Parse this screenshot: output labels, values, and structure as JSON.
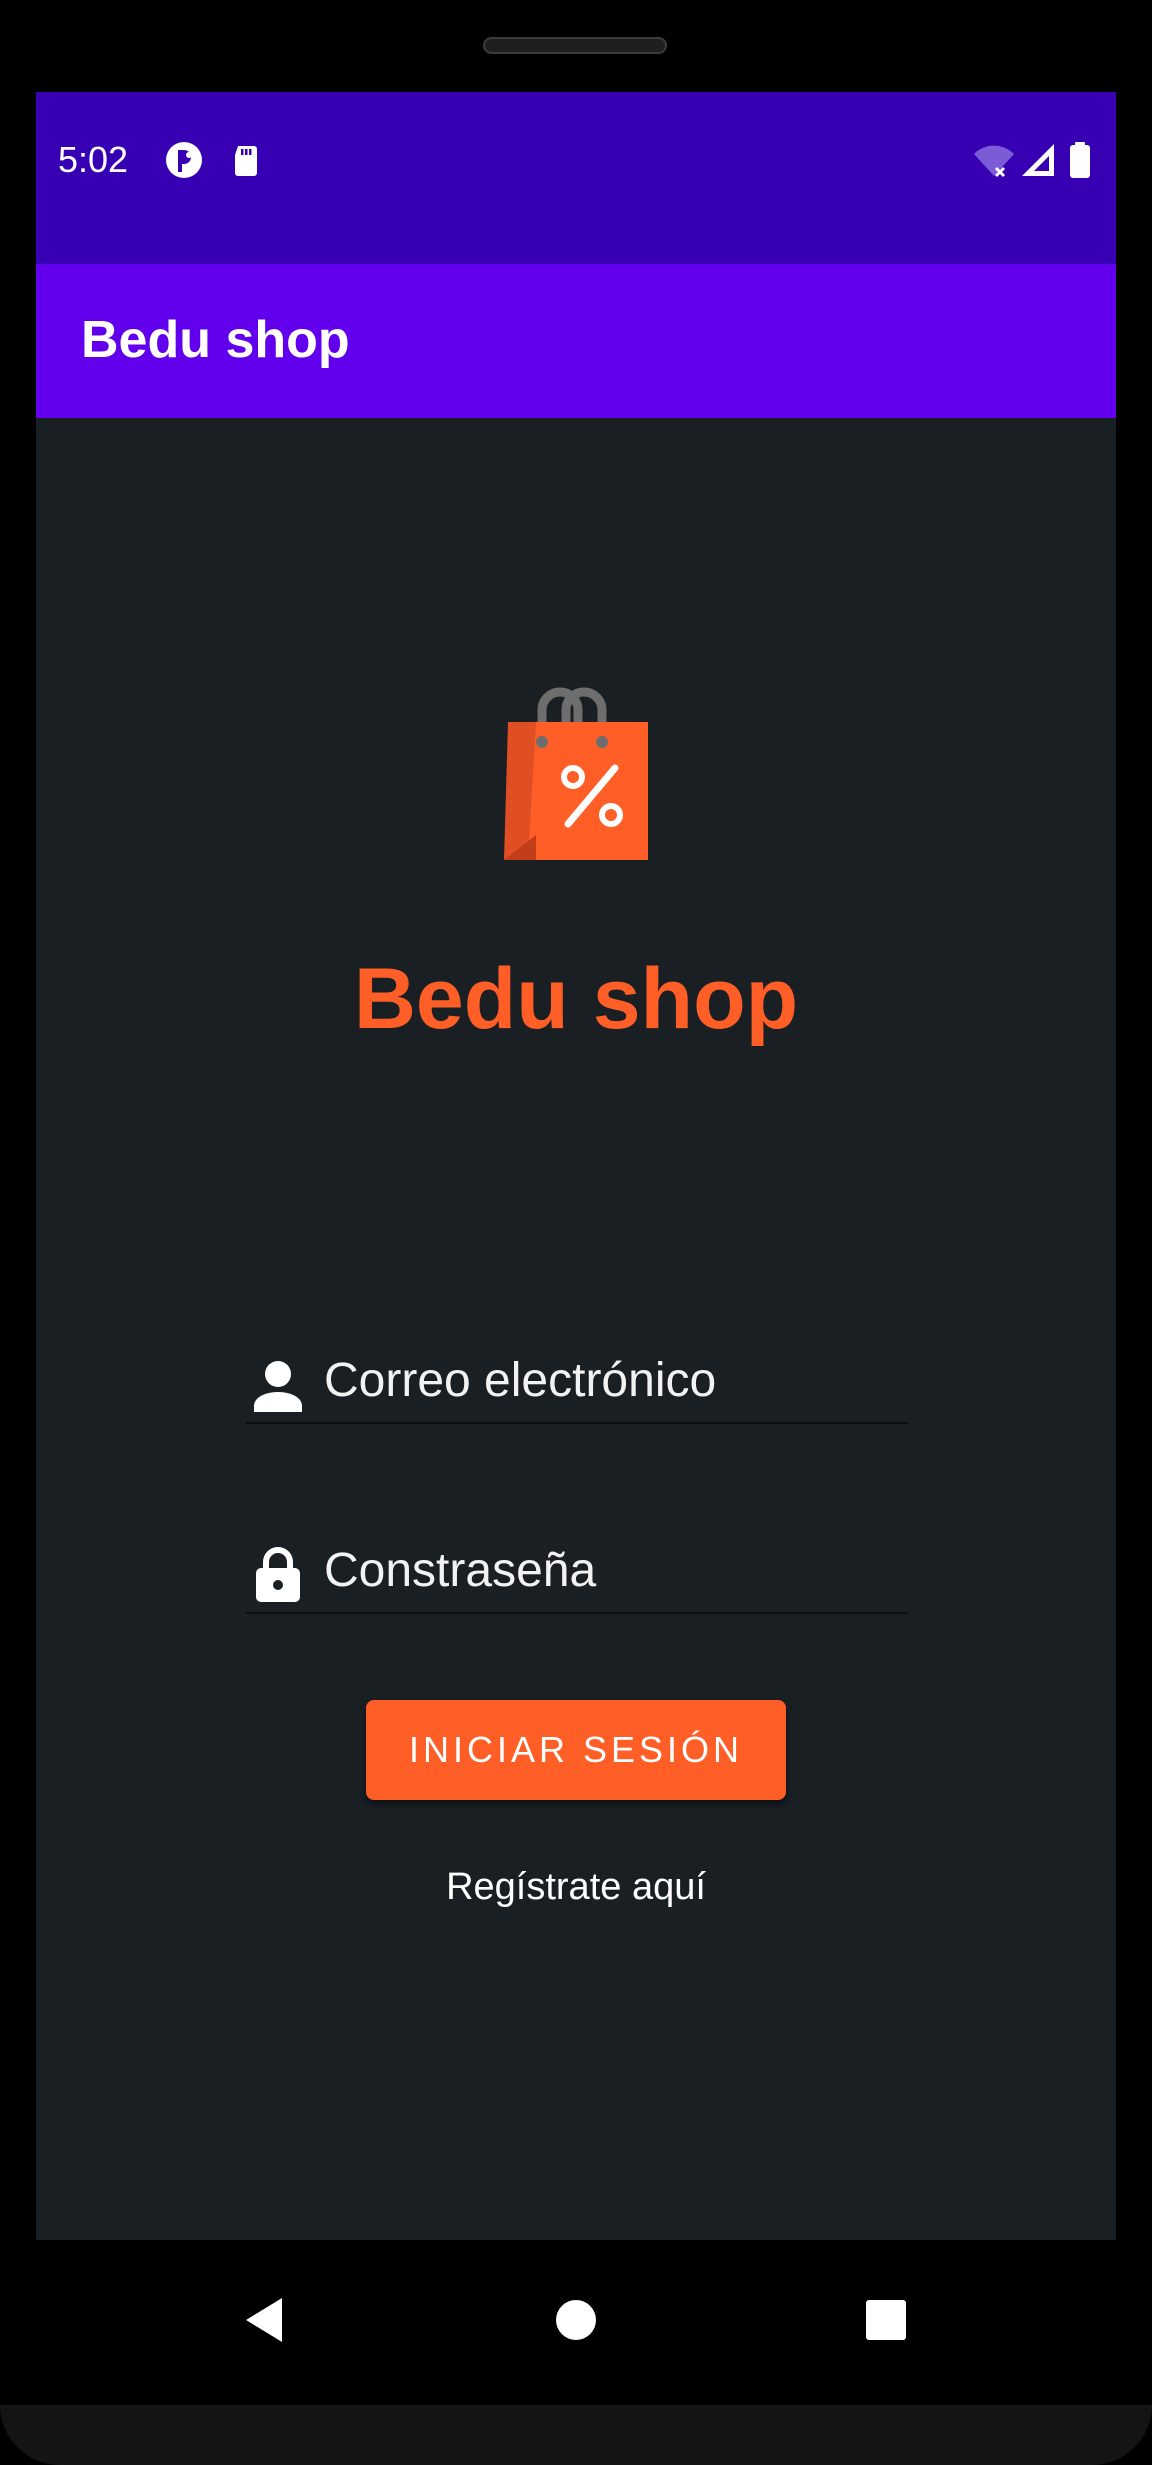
{
  "status_bar": {
    "time": "5:02",
    "left_icons": [
      "notification-icon",
      "sd-card-icon"
    ],
    "right_icons": [
      "wifi-off-icon",
      "cell-signal-icon",
      "battery-icon"
    ]
  },
  "app_bar": {
    "title": "Bedu shop"
  },
  "main": {
    "logo_icon": "shopping-bag-discount-icon",
    "brand_title": "Bedu shop",
    "email_field": {
      "icon": "person-icon",
      "placeholder": "Correo electrónico",
      "value": ""
    },
    "password_field": {
      "icon": "lock-icon",
      "placeholder": "Constraseña",
      "value": ""
    },
    "login_button_label": "INICIAR SESIÓN",
    "register_link": "Regístrate aquí"
  },
  "nav_bar": {
    "buttons": [
      "back-icon",
      "home-icon",
      "recents-icon"
    ]
  },
  "colors": {
    "status_bar": "#3700b3",
    "app_bar": "#6200ee",
    "background": "#1a1f24",
    "accent": "#ff5e26"
  }
}
